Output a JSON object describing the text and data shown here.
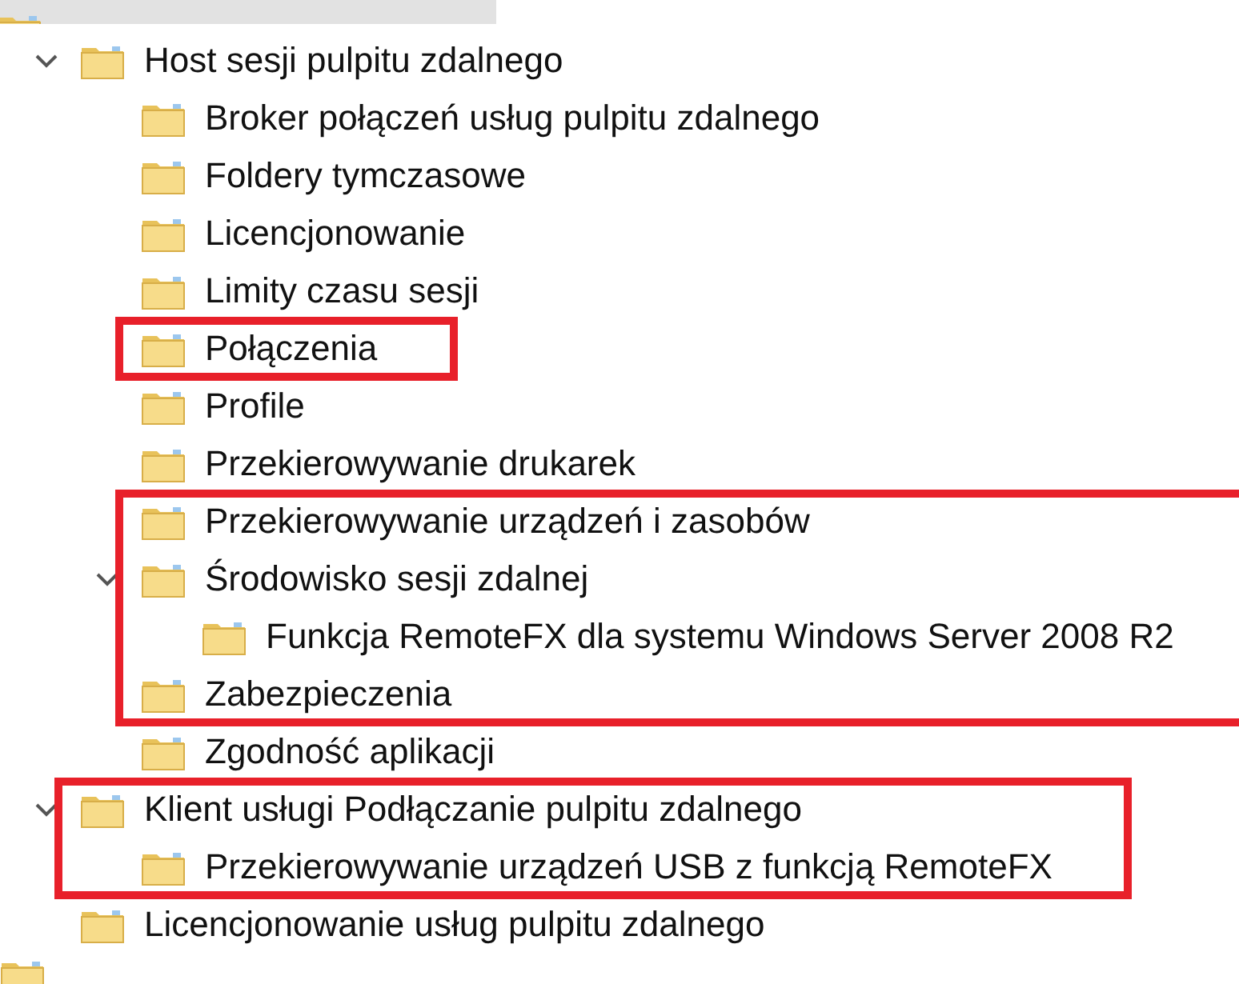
{
  "tree": [
    {
      "label": "Host sesji pulpitu zdalnego",
      "expanded": true,
      "boxed": false,
      "children": [
        {
          "label": "Broker połączeń usług pulpitu zdalnego",
          "boxed": false
        },
        {
          "label": "Foldery tymczasowe",
          "boxed": false
        },
        {
          "label": "Licencjonowanie",
          "boxed": false
        },
        {
          "label": "Limity czasu sesji",
          "boxed": false
        },
        {
          "label": "Połączenia",
          "boxed": true
        },
        {
          "label": "Profile",
          "boxed": false
        },
        {
          "label": "Przekierowywanie drukarek",
          "boxed": false
        },
        {
          "label": "Przekierowywanie urządzeń i zasobów",
          "boxed": true
        },
        {
          "label": "Środowisko sesji zdalnej",
          "expanded": true,
          "boxed": true,
          "children": [
            {
              "label": "Funkcja RemoteFX dla systemu Windows Server 2008 R2",
              "boxed": true
            }
          ]
        },
        {
          "label": "Zabezpieczenia",
          "boxed": true
        },
        {
          "label": "Zgodność aplikacji",
          "boxed": false
        }
      ]
    },
    {
      "label": "Klient usługi Podłączanie pulpitu zdalnego",
      "expanded": true,
      "boxed": true,
      "children": [
        {
          "label": "Przekierowywanie urządzeń USB z funkcją RemoteFX",
          "boxed": true
        }
      ]
    },
    {
      "label": "Licencjonowanie usług pulpitu zdalnego",
      "boxed": false
    }
  ]
}
